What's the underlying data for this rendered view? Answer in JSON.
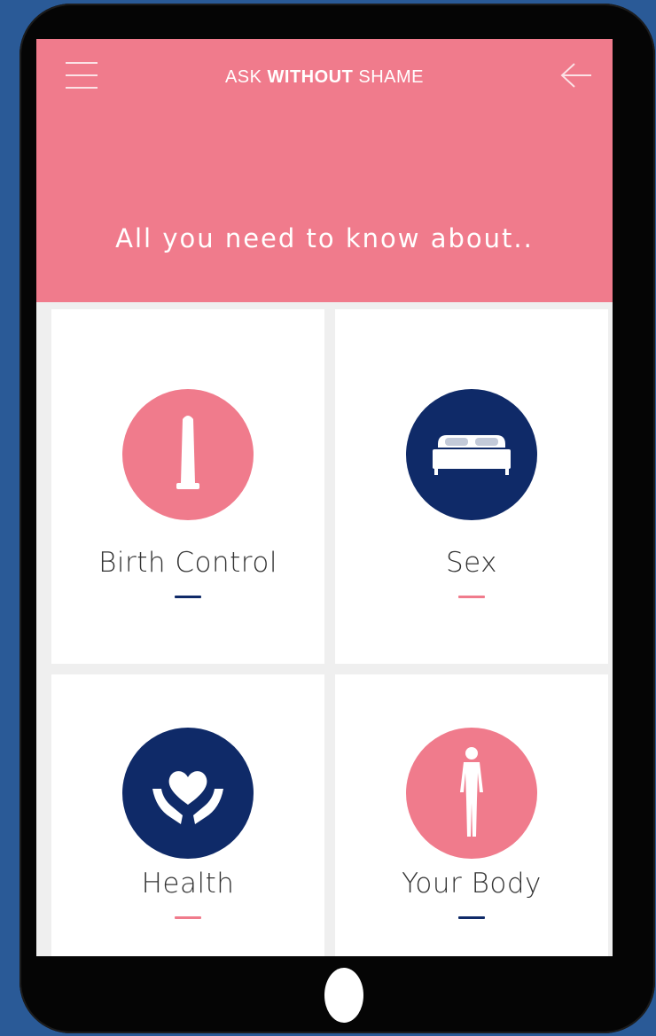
{
  "app": {
    "logo_part1": "ASK ",
    "logo_part2": "WITH",
    "logo_part3": "OUT",
    "logo_part4": " SHAME"
  },
  "header": {
    "subtitle": "All you need to know about.."
  },
  "topics": [
    {
      "label": "Birth Control",
      "icon": "condom-icon",
      "circle_color": "#f07b8c",
      "dash_color": "#0f2a68"
    },
    {
      "label": "Sex",
      "icon": "bed-icon",
      "circle_color": "#0f2a68",
      "dash_color": "#f07b8c"
    },
    {
      "label": "Health",
      "icon": "heart-hands-icon",
      "circle_color": "#0f2a68",
      "dash_color": "#f07b8c"
    },
    {
      "label": "Your Body",
      "icon": "human-body-icon",
      "circle_color": "#f07b8c",
      "dash_color": "#0f2a68"
    }
  ],
  "colors": {
    "brand_pink": "#f07b8c",
    "brand_navy": "#0f2a68",
    "background_blue": "#2a5a97"
  }
}
